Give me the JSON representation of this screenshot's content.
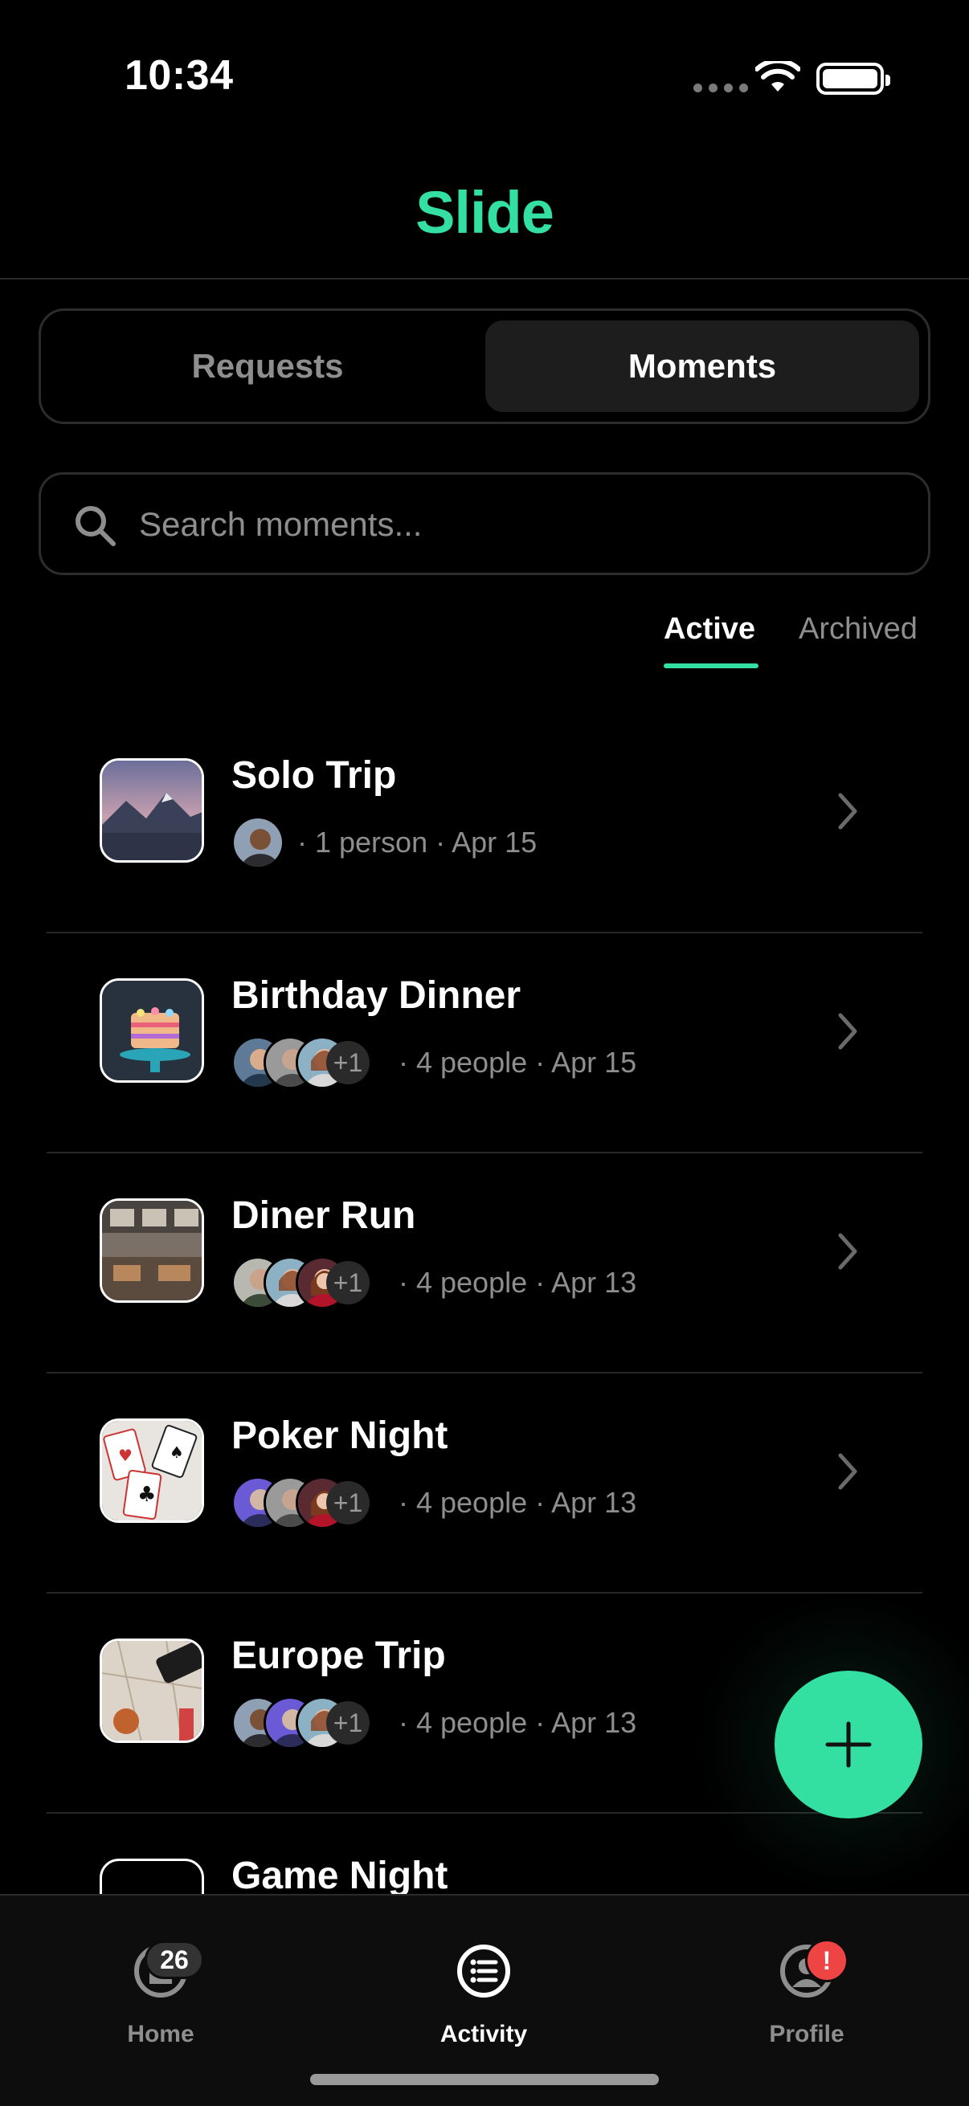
{
  "status_bar": {
    "time": "10:34"
  },
  "header": {
    "logo": "Slide"
  },
  "segmented": {
    "requests": "Requests",
    "moments": "Moments"
  },
  "search": {
    "placeholder": "Search moments..."
  },
  "filters": {
    "active": "Active",
    "archived": "Archived"
  },
  "moments": [
    {
      "title": "Solo Trip",
      "meta": "· 1 person · Apr 15",
      "more": ""
    },
    {
      "title": "Birthday Dinner",
      "meta": "· 4 people · Apr 15",
      "more": "+1"
    },
    {
      "title": "Diner Run",
      "meta": "· 4 people · Apr 13",
      "more": "+1"
    },
    {
      "title": "Poker Night",
      "meta": "· 4 people · Apr 13",
      "more": "+1"
    },
    {
      "title": "Europe Trip",
      "meta": "· 4 people · Apr 13",
      "more": "+1"
    },
    {
      "title": "Game Night",
      "meta": "",
      "more": ""
    }
  ],
  "tabbar": {
    "home": {
      "label": "Home",
      "badge": "26"
    },
    "activity": {
      "label": "Activity"
    },
    "profile": {
      "label": "Profile",
      "badge": "!"
    }
  },
  "colors": {
    "accent": "#33e0a1",
    "alert": "#ef4444"
  },
  "icons": [
    "search-icon",
    "chevron-right-icon",
    "plus-icon",
    "home-icon",
    "activity-list-icon",
    "profile-icon",
    "wifi-icon",
    "battery-icon"
  ]
}
